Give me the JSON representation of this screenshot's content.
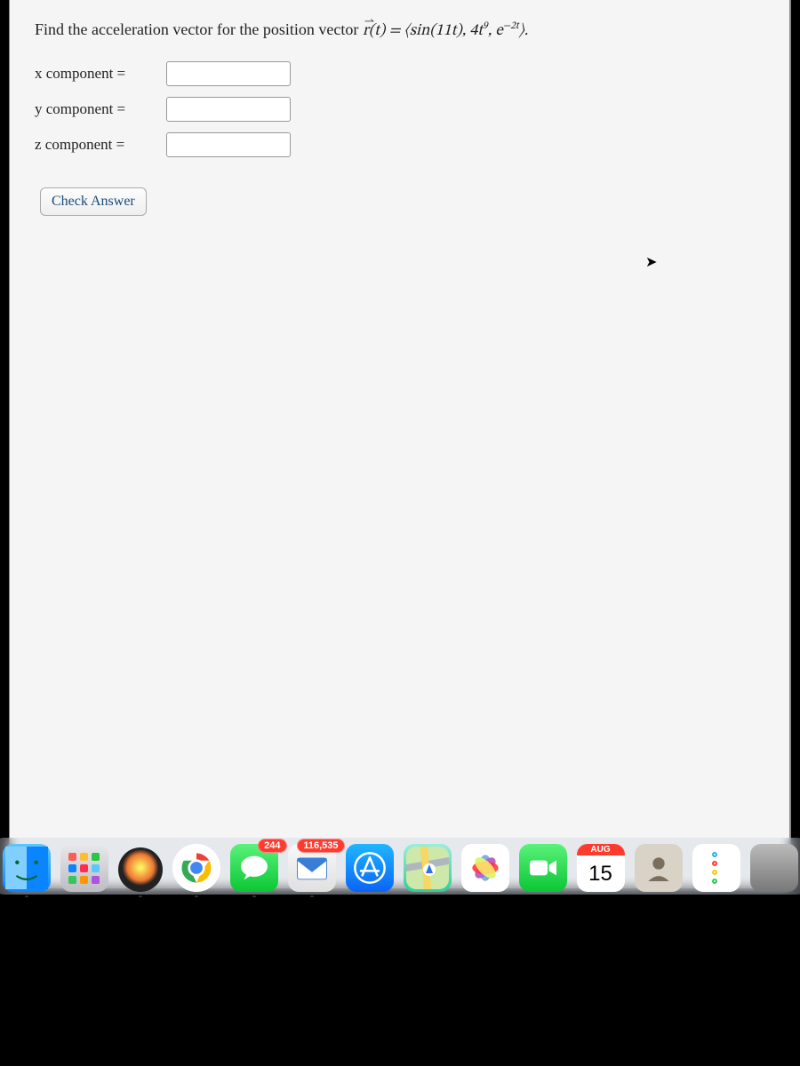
{
  "problem": {
    "prompt_prefix": "Find the acceleration vector for the position vector ",
    "vector_expr": "r⃗(t) = ⟨sin(11t), 4t⁹, e⁻²ᵗ⟩.",
    "x_label": "x component =",
    "y_label": "y component =",
    "z_label": "z component =",
    "x_value": "",
    "y_value": "",
    "z_value": "",
    "check_label": "Check Answer"
  },
  "dock": {
    "messages_badge": "244",
    "mail_badge": "116,535",
    "calendar_month": "AUG",
    "calendar_day": "15",
    "reminder_colors": [
      "#2cb0e6",
      "#ff3b30",
      "#ffcc00",
      "#34c759"
    ]
  }
}
